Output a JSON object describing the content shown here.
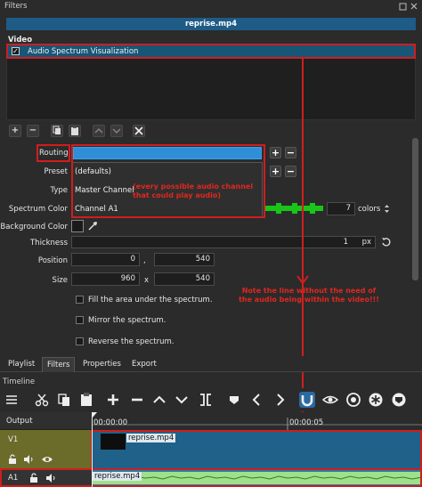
{
  "filters_panel": {
    "title": "Filters",
    "clip_name": "reprise.mp4",
    "video_label": "Video",
    "filter_items": [
      {
        "label": "Audio Spectrum Visualization",
        "checked": true
      }
    ]
  },
  "form": {
    "routing_label": "Routing",
    "preset_label": "Preset",
    "type_label": "Type",
    "spectrum_color_label": "Spectrum Color",
    "background_color_label": "Background Color",
    "thickness_label": "Thickness",
    "position_label": "Position",
    "size_label": "Size",
    "colors_value": "7",
    "colors_label": "colors",
    "thickness_value": "1",
    "thickness_unit": "px",
    "position_x": "0",
    "position_y": "540",
    "size_w": "960",
    "size_h": "540",
    "comma": ",",
    "times": "x",
    "checkbox_fill": "Fill the area under the spectrum.",
    "checkbox_mirror": "Mirror the spectrum.",
    "checkbox_reverse": "Reverse the spectrum.",
    "routing_options": [
      "(defaults)",
      "Master Channel",
      "Channel A1"
    ]
  },
  "annotations": {
    "dropdown_note_line1": "(every possible audio channel",
    "dropdown_note_line2": "that could play audio)",
    "timeline_note_line1": "Note the line without the need of",
    "timeline_note_line2": "the audio being within the video!!!"
  },
  "tabs": [
    "Playlist",
    "Filters",
    "Properties",
    "Export"
  ],
  "timeline": {
    "title": "Timeline",
    "output_label": "Output",
    "tracks": [
      {
        "name": "V1",
        "clip": "reprise.mp4"
      },
      {
        "name": "A1",
        "clip": "reprise.mp4"
      }
    ],
    "ruler": [
      "00:00:00",
      "00:00:05"
    ]
  },
  "colors": {
    "accent_red": "#d11d1d",
    "spectrum_green": "#19c519",
    "selection_blue": "#1e5b86"
  }
}
